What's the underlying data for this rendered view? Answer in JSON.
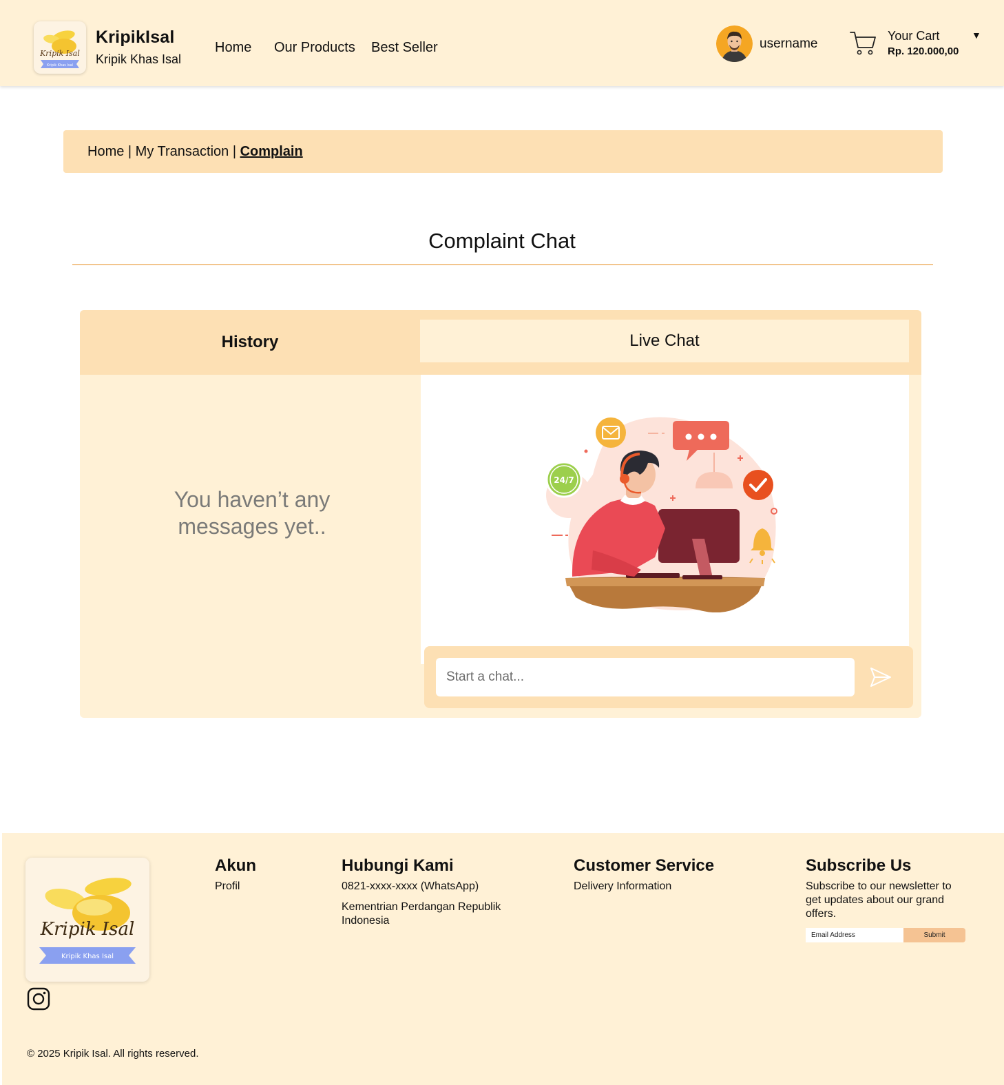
{
  "header": {
    "brand_name": "KripikIsal",
    "brand_tagline": "Kripik Khas Isal",
    "logo_text": "Kripik Isal",
    "logo_ribbon": "Kripik Khas Isal",
    "nav": [
      "Home",
      "Our Products",
      "Best Seller"
    ],
    "username": "username",
    "cart_title": "Your Cart",
    "cart_total": "Rp. 120.000,00",
    "cart_caret": "▼"
  },
  "breadcrumb": {
    "items": [
      "Home",
      " | ",
      "My Transaction",
      " | ",
      "Complain"
    ]
  },
  "page": {
    "title": "Complaint Chat"
  },
  "chat": {
    "tab_history": "History",
    "tab_live": "Live Chat",
    "empty_message": "You haven’t any messages yet..",
    "badge_247": "24/7",
    "input_placeholder": "Start a chat..."
  },
  "footer": {
    "logo_text": "Kripik Isal",
    "logo_ribbon": "Kripik Khas Isal",
    "akun_title": "Akun",
    "akun_link": "Profil",
    "contact_title": "Hubungi Kami",
    "contact_phone": "0821-xxxx-xxxx (WhatsApp)",
    "contact_address": "Kementrian Perdangan Republik Indonesia",
    "cs_title": "Customer Service",
    "cs_link": "Delivery Information",
    "subscribe_title": "Subscribe Us",
    "subscribe_text": "Subscribe to our newsletter to get updates about our grand offers.",
    "email_placeholder": "Email Address",
    "submit_label": "Submit",
    "copyright": "© 2025 Kripik Isal. All rights reserved."
  },
  "colors": {
    "cream": "#fff1d6",
    "peach": "#fde0b4",
    "accent_line": "#f2c58d",
    "submit": "#f5c393"
  },
  "icons": [
    "cart-icon",
    "send-icon",
    "instagram-icon",
    "avatar-icon",
    "chips-logo-icon"
  ]
}
